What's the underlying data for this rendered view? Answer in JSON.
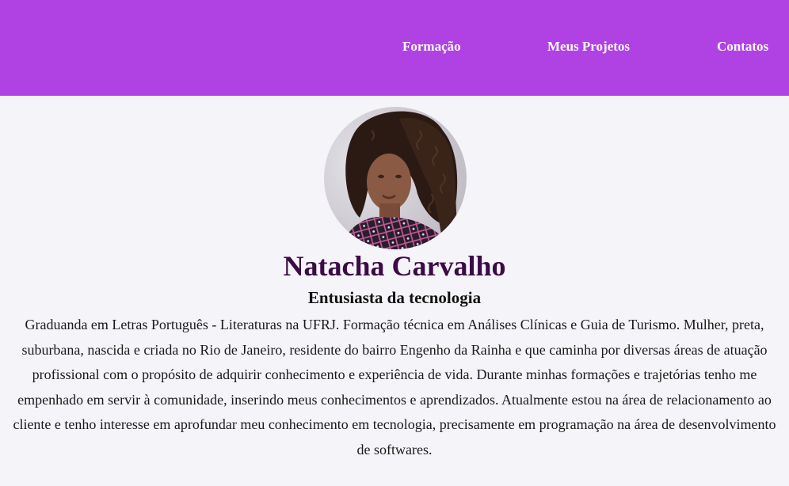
{
  "nav": {
    "items": [
      {
        "label": "Formação"
      },
      {
        "label": "Meus Projetos"
      },
      {
        "label": "Contatos"
      }
    ]
  },
  "profile": {
    "name": "Natacha Carvalho",
    "tagline": "Entusiasta da tecnologia",
    "bio": "Graduanda em Letras Português - Literaturas na UFRJ. Formação técnica em Análises Clínicas e Guia de Turismo. Mulher, preta, suburbana, nascida e criada no Rio de Janeiro, residente do bairro Engenho da Rainha e que caminha por diversas áreas de atuação profissional com o propósito de adquirir conhecimento e experiência de vida. Durante minhas formações e trajetórias tenho me empenhado em servir à comunidade, inserindo meus conhecimentos e aprendizados. Atualmente estou na área de relacionamento ao cliente e tenho interesse em aprofundar meu conhecimento em tecnologia, precisamente em programação na área de desenvolvimento de softwares."
  },
  "colors": {
    "header_bg": "#b042e4",
    "page_bg": "#f5f4f8",
    "name_color": "#3c0a47",
    "nav_text": "#ffffff"
  }
}
